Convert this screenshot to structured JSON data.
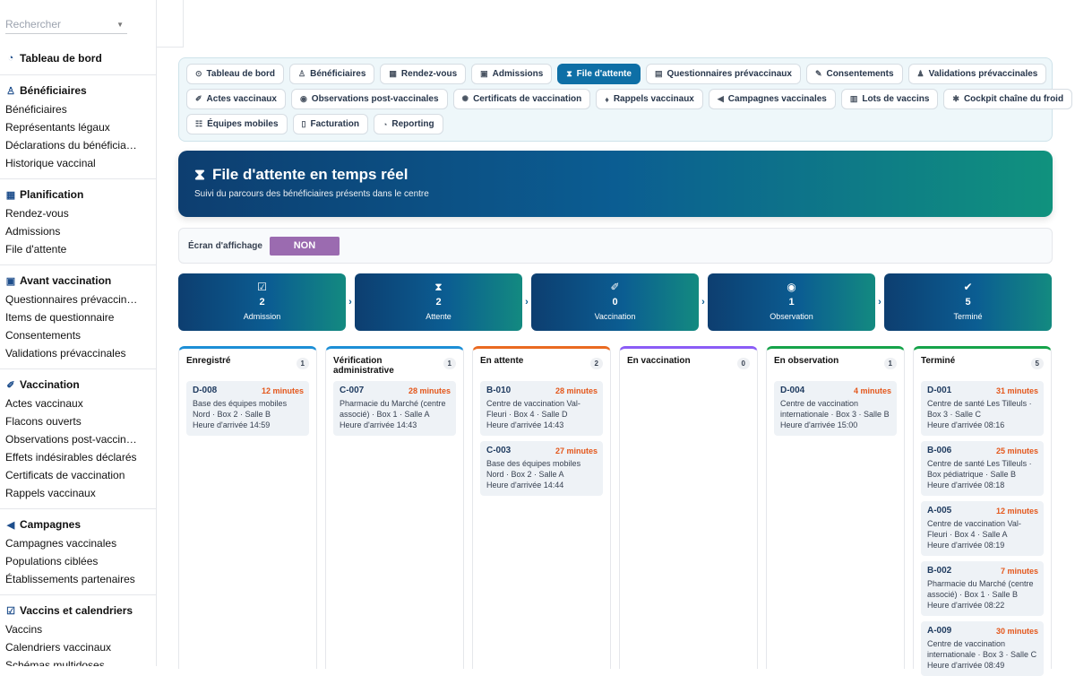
{
  "sidebar": {
    "search_placeholder": "Rechercher",
    "sections": [
      {
        "title": "Tableau de bord",
        "icon": "gauge-icon",
        "items": []
      },
      {
        "title": "Bénéficiaires",
        "icon": "people-icon",
        "items": [
          "Bénéficiaires",
          "Représentants légaux",
          "Déclarations du bénéficia…",
          "Historique vaccinal"
        ]
      },
      {
        "title": "Planification",
        "icon": "calendar-icon",
        "items": [
          "Rendez-vous",
          "Admissions",
          "File d'attente"
        ]
      },
      {
        "title": "Avant vaccination",
        "icon": "clipboard-icon",
        "items": [
          "Questionnaires prévaccin…",
          "Items de questionnaire",
          "Consentements",
          "Validations prévaccinales"
        ]
      },
      {
        "title": "Vaccination",
        "icon": "syringe-icon",
        "items": [
          "Actes vaccinaux",
          "Flacons ouverts",
          "Observations post-vaccin…",
          "Effets indésirables déclarés",
          "Certificats de vaccination",
          "Rappels vaccinaux"
        ]
      },
      {
        "title": "Campagnes",
        "icon": "megaphone-icon",
        "items": [
          "Campagnes vaccinales",
          "Populations ciblées",
          "Établissements partenaires"
        ]
      },
      {
        "title": "Vaccins et calendriers",
        "icon": "calendar-check-icon",
        "items": [
          "Vaccins",
          "Calendriers vaccinaux",
          "Schémas multidoses"
        ]
      }
    ]
  },
  "tabs": {
    "rows": [
      [
        {
          "label": "Tableau de bord",
          "icon": "⊙",
          "active": false
        },
        {
          "label": "Bénéficiaires",
          "icon": "♙",
          "active": false
        },
        {
          "label": "Rendez-vous",
          "icon": "▦",
          "active": false
        },
        {
          "label": "Admissions",
          "icon": "▣",
          "active": false
        },
        {
          "label": "File d'attente",
          "icon": "⧗",
          "active": true
        },
        {
          "label": "Questionnaires prévaccinaux",
          "icon": "▤",
          "active": false
        },
        {
          "label": "Consentements",
          "icon": "✎",
          "active": false
        },
        {
          "label": "Validations prévaccinales",
          "icon": "♟",
          "active": false
        }
      ],
      [
        {
          "label": "Actes vaccinaux",
          "icon": "✐",
          "active": false
        },
        {
          "label": "Observations post-vaccinales",
          "icon": "◉",
          "active": false
        },
        {
          "label": "Certificats de vaccination",
          "icon": "✺",
          "active": false
        },
        {
          "label": "Rappels vaccinaux",
          "icon": "♦",
          "active": false
        },
        {
          "label": "Campagnes vaccinales",
          "icon": "◀",
          "active": false
        },
        {
          "label": "Lots de vaccins",
          "icon": "▥",
          "active": false
        },
        {
          "label": "Cockpit chaîne du froid",
          "icon": "✱",
          "active": false
        }
      ],
      [
        {
          "label": "Équipes mobiles",
          "icon": "☷",
          "active": false
        },
        {
          "label": "Facturation",
          "icon": "▯",
          "active": false
        },
        {
          "label": "Reporting",
          "icon": "◔",
          "active": false
        }
      ]
    ]
  },
  "hero": {
    "title": "File d'attente en temps réel",
    "subtitle": "Suivi du parcours des bénéficiaires présents dans le centre"
  },
  "display": {
    "label": "Écran d'affichage",
    "toggle_value": "NON"
  },
  "stages": [
    {
      "icon": "☑",
      "value": "2",
      "label": "Admission"
    },
    {
      "icon": "⧗",
      "value": "2",
      "label": "Attente"
    },
    {
      "icon": "✐",
      "value": "0",
      "label": "Vaccination"
    },
    {
      "icon": "◉",
      "value": "1",
      "label": "Observation"
    },
    {
      "icon": "✔",
      "value": "5",
      "label": "Terminé"
    }
  ],
  "columns": [
    {
      "title": "Enregistré",
      "count": "1",
      "color": "#1d8fd6",
      "cards": [
        {
          "id": "D-008",
          "duration": "12 minutes",
          "location": "Base des équipes mobiles Nord · Box 2 · Salle B",
          "arrival": "Heure d'arrivée 14:59"
        }
      ]
    },
    {
      "title": "Vérification administrative",
      "count": "1",
      "color": "#1d8fd6",
      "cards": [
        {
          "id": "C-007",
          "duration": "28 minutes",
          "location": "Pharmacie du Marché (centre associé) · Box 1 · Salle A",
          "arrival": "Heure d'arrivée 14:43"
        }
      ]
    },
    {
      "title": "En attente",
      "count": "2",
      "color": "#ea6a21",
      "cards": [
        {
          "id": "B-010",
          "duration": "28 minutes",
          "location": "Centre de vaccination Val-Fleuri · Box 4 · Salle D",
          "arrival": "Heure d'arrivée 14:43"
        },
        {
          "id": "C-003",
          "duration": "27 minutes",
          "location": "Base des équipes mobiles Nord · Box 2 · Salle A",
          "arrival": "Heure d'arrivée 14:44"
        }
      ]
    },
    {
      "title": "En vaccination",
      "count": "0",
      "color": "#8b5cf6",
      "cards": []
    },
    {
      "title": "En observation",
      "count": "1",
      "color": "#16a34a",
      "cards": [
        {
          "id": "D-004",
          "duration": "4 minutes",
          "location": "Centre de vaccination internationale · Box 3 · Salle B",
          "arrival": "Heure d'arrivée 15:00"
        }
      ]
    },
    {
      "title": "Terminé",
      "count": "5",
      "color": "#16a34a",
      "cards": [
        {
          "id": "D-001",
          "duration": "31 minutes",
          "location": "Centre de santé Les Tilleuls · Box 3 · Salle C",
          "arrival": "Heure d'arrivée 08:16"
        },
        {
          "id": "B-006",
          "duration": "25 minutes",
          "location": "Centre de santé Les Tilleuls · Box pédiatrique · Salle B",
          "arrival": "Heure d'arrivée 08:18"
        },
        {
          "id": "A-005",
          "duration": "12 minutes",
          "location": "Centre de vaccination Val-Fleuri · Box 4 · Salle A",
          "arrival": "Heure d'arrivée 08:19"
        },
        {
          "id": "B-002",
          "duration": "7 minutes",
          "location": "Pharmacie du Marché (centre associé) · Box 1 · Salle B",
          "arrival": "Heure d'arrivée 08:22"
        },
        {
          "id": "A-009",
          "duration": "30 minutes",
          "location": "Centre de vaccination internationale · Box 3 · Salle C",
          "arrival": "Heure d'arrivée 08:49"
        }
      ]
    }
  ]
}
